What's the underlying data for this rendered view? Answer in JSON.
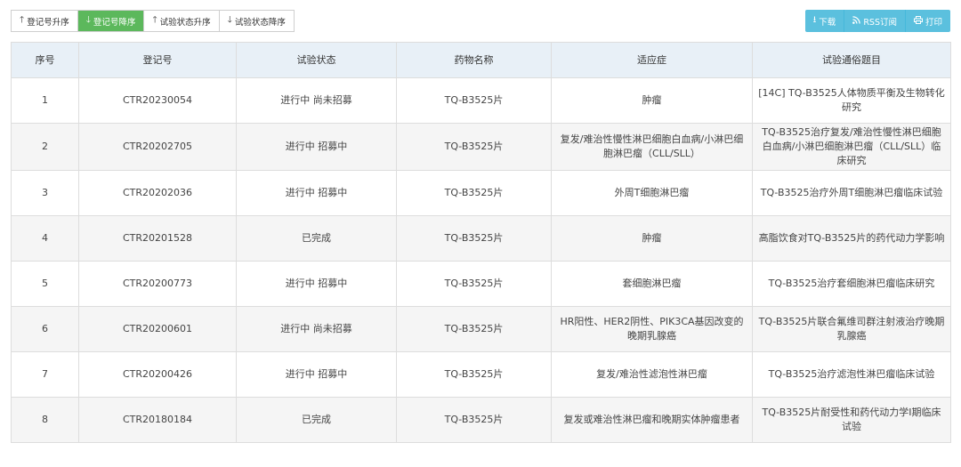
{
  "sort_buttons": [
    {
      "label": "登记号升序",
      "arrow": "🡑"
    },
    {
      "label": "登记号降序",
      "arrow": "🡓"
    },
    {
      "label": "试验状态升序",
      "arrow": "🡑"
    },
    {
      "label": "试验状态降序",
      "arrow": "🡓"
    }
  ],
  "active_sort": 1,
  "actions": [
    {
      "label": "下载",
      "icon": "download-icon"
    },
    {
      "label": "RSS订阅",
      "icon": "rss-icon"
    },
    {
      "label": "打印",
      "icon": "print-icon"
    }
  ],
  "colors": {
    "active_sort": "#5cb85c",
    "action": "#5bc0de",
    "header_bg": "#e8f0f7"
  },
  "table": {
    "headers": [
      "序号",
      "登记号",
      "试验状态",
      "药物名称",
      "适应症",
      "试验通俗题目"
    ],
    "rows": [
      [
        "1",
        "CTR20230054",
        "进行中 尚未招募",
        "TQ-B3525片",
        "肿瘤",
        "[14C] TQ-B3525人体物质平衡及生物转化研究"
      ],
      [
        "2",
        "CTR20202705",
        "进行中 招募中",
        "TQ-B3525片",
        "复发/难治性慢性淋巴细胞白血病/小淋巴细胞淋巴瘤（CLL/SLL）",
        "TQ-B3525治疗复发/难治性慢性淋巴细胞白血病/小淋巴细胞淋巴瘤（CLL/SLL）临床研究"
      ],
      [
        "3",
        "CTR20202036",
        "进行中 招募中",
        "TQ-B3525片",
        "外周T细胞淋巴瘤",
        "TQ-B3525治疗外周T细胞淋巴瘤临床试验"
      ],
      [
        "4",
        "CTR20201528",
        "已完成",
        "TQ-B3525片",
        "肿瘤",
        "高脂饮食对TQ-B3525片的药代动力学影响"
      ],
      [
        "5",
        "CTR20200773",
        "进行中 招募中",
        "TQ-B3525片",
        "套细胞淋巴瘤",
        "TQ-B3525治疗套细胞淋巴瘤临床研究"
      ],
      [
        "6",
        "CTR20200601",
        "进行中 尚未招募",
        "TQ-B3525片",
        "HR阳性、HER2阴性、PIK3CA基因改变的晚期乳腺癌",
        "TQ-B3525片联合氟维司群注射液治疗晚期乳腺癌"
      ],
      [
        "7",
        "CTR20200426",
        "进行中 招募中",
        "TQ-B3525片",
        "复发/难治性滤泡性淋巴瘤",
        "TQ-B3525治疗滤泡性淋巴瘤临床试验"
      ],
      [
        "8",
        "CTR20180184",
        "已完成",
        "TQ-B3525片",
        "复发或难治性淋巴瘤和晚期实体肿瘤患者",
        "TQ-B3525片耐受性和药代动力学I期临床试验"
      ]
    ]
  }
}
